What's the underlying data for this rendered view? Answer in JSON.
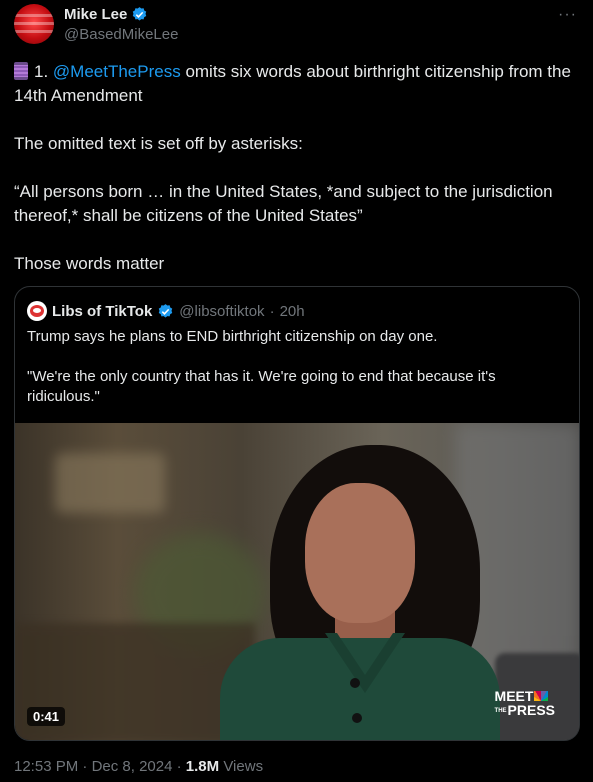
{
  "author": {
    "name": "Mike Lee",
    "handle": "@BasedMikeLee",
    "verified": true,
    "more_icon": "more-options-icon"
  },
  "tweet": {
    "line1_prefix": "1. ",
    "mention": "@MeetThePress",
    "line1_rest": " omits six words about birthright citizenship from the 14th Amendment",
    "para2": "The omitted text is set off by asterisks:",
    "para3": "“All persons born … in the United States, *and subject to the jurisdiction thereof,* shall be citizens of the United States”",
    "para4": "Those words matter"
  },
  "quoted": {
    "name": "Libs of TikTok",
    "handle": "@libsoftiktok",
    "separator": "·",
    "time": "20h",
    "verified": true,
    "para1": "Trump says he plans to END birthright citizenship on day one.",
    "para2": "\"We're the only country that has it. We're going to end that because it's ridiculous.\"",
    "video_duration": "0:41",
    "logo_line1": "MEET",
    "logo_the": "THE",
    "logo_line2": "PRESS"
  },
  "meta": {
    "time": "12:53 PM",
    "separator": "·",
    "date": "Dec 8, 2024",
    "views_count": "1.8M",
    "views_label": "Views"
  },
  "colors": {
    "background": "#000000",
    "text": "#e7e9ea",
    "muted": "#71767b",
    "link": "#1d9bf0",
    "border": "#2f3336"
  }
}
